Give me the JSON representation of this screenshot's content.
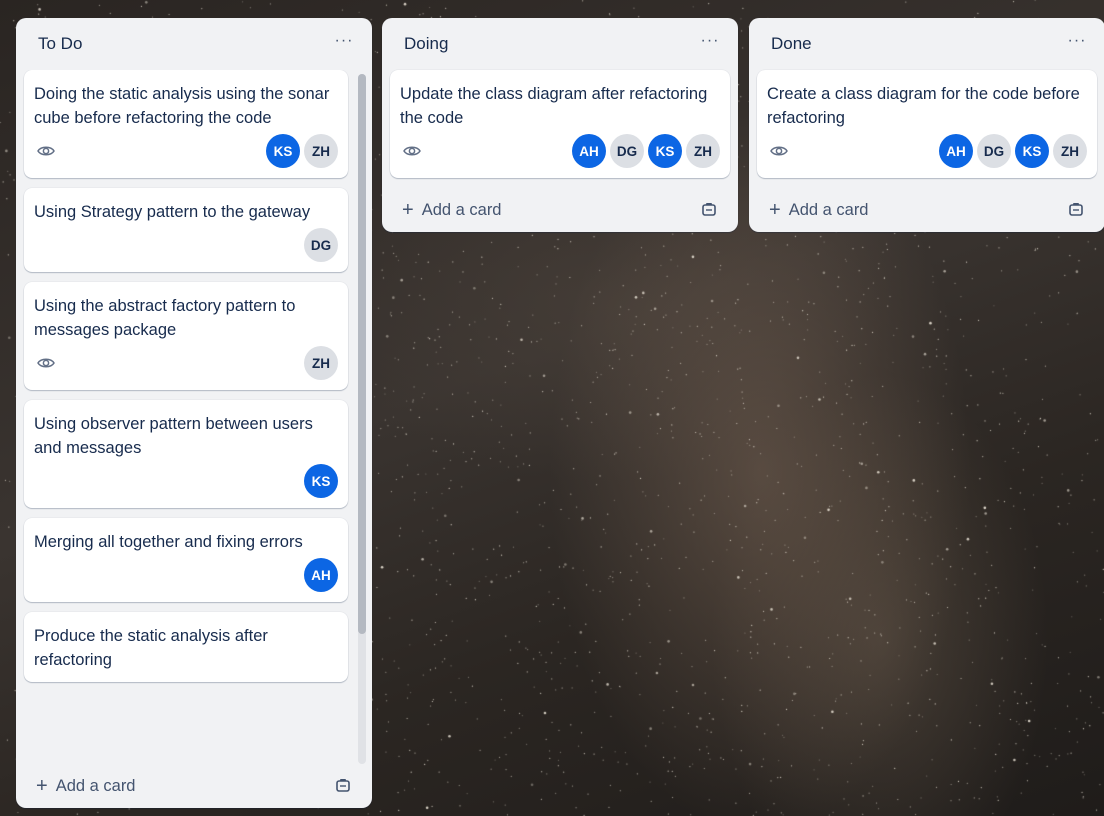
{
  "theme": {
    "avatar_blue": "#0c66e4",
    "avatar_gray": "#dcdfe4",
    "list_bg": "#f1f2f4",
    "text": "#172b4d"
  },
  "lists": [
    {
      "title": "To Do",
      "menu": "···",
      "add_card": "Add a card",
      "cards": [
        {
          "title": "Doing the static analysis using the sonar cube before refactoring the code",
          "watch": true,
          "members": [
            {
              "initials": "KS",
              "color": "blue"
            },
            {
              "initials": "ZH",
              "color": "gray"
            }
          ]
        },
        {
          "title": "Using Strategy pattern to the gateway",
          "watch": false,
          "members": [
            {
              "initials": "DG",
              "color": "gray"
            }
          ]
        },
        {
          "title": "Using the abstract factory pattern to messages package",
          "watch": true,
          "members": [
            {
              "initials": "ZH",
              "color": "gray"
            }
          ]
        },
        {
          "title": "Using observer pattern between users and messages",
          "watch": false,
          "members": [
            {
              "initials": "KS",
              "color": "blue"
            }
          ]
        },
        {
          "title": "Merging all together and fixing errors",
          "watch": false,
          "members": [
            {
              "initials": "AH",
              "color": "blue"
            }
          ]
        },
        {
          "title": "Produce the static analysis after refactoring",
          "watch": false,
          "members": []
        }
      ]
    },
    {
      "title": "Doing",
      "menu": "···",
      "add_card": "Add a card",
      "cards": [
        {
          "title": "Update the class diagram after refactoring the code",
          "watch": true,
          "members": [
            {
              "initials": "AH",
              "color": "blue"
            },
            {
              "initials": "DG",
              "color": "gray"
            },
            {
              "initials": "KS",
              "color": "blue"
            },
            {
              "initials": "ZH",
              "color": "gray"
            }
          ]
        }
      ]
    },
    {
      "title": "Done",
      "menu": "···",
      "add_card": "Add a card",
      "cards": [
        {
          "title": "Create a class diagram for the code before refactoring",
          "watch": true,
          "members": [
            {
              "initials": "AH",
              "color": "blue"
            },
            {
              "initials": "DG",
              "color": "gray"
            },
            {
              "initials": "KS",
              "color": "blue"
            },
            {
              "initials": "ZH",
              "color": "gray"
            }
          ]
        }
      ]
    }
  ]
}
